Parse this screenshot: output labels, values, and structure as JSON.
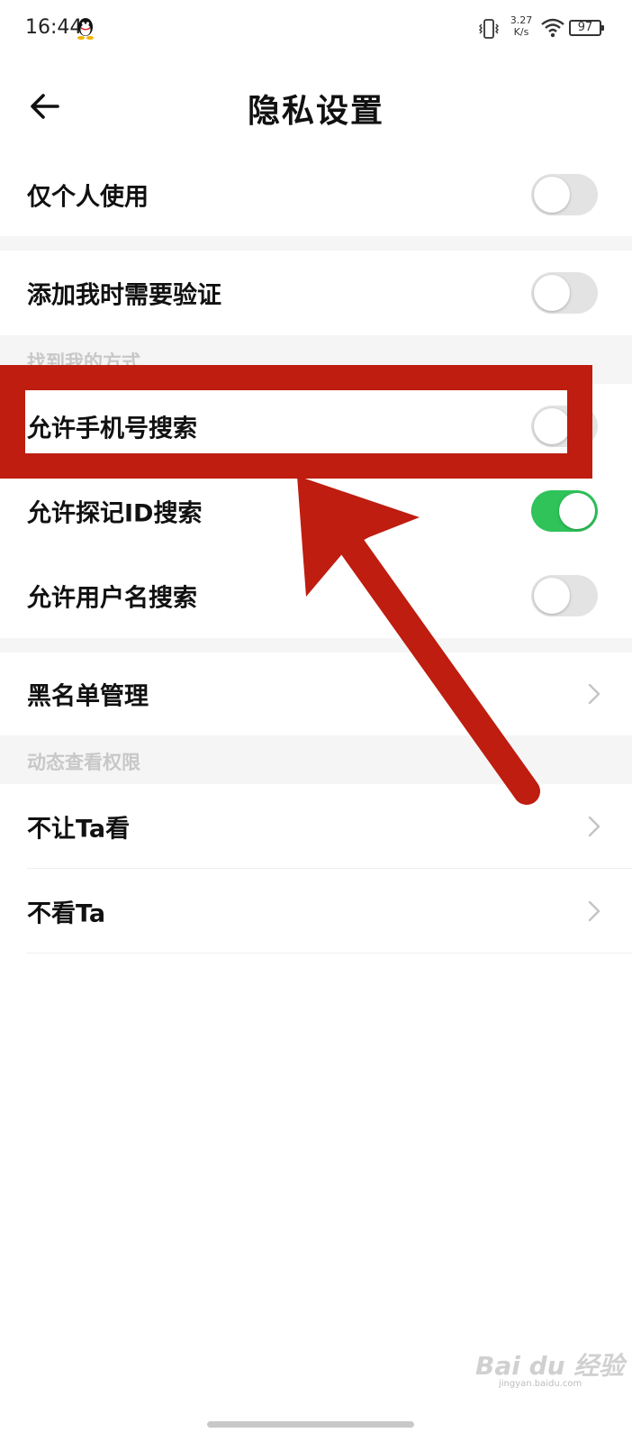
{
  "status_bar": {
    "time": "16:44",
    "net_speed_value": "3.27",
    "net_speed_unit": "K/s",
    "battery": "97"
  },
  "header": {
    "title": "隐私设置"
  },
  "rows": {
    "personal_only": {
      "label": "仅个人使用",
      "enabled": false
    },
    "verify_add": {
      "label": "添加我时需要验证",
      "enabled": false
    },
    "phone_search": {
      "label": "允许手机号搜索",
      "enabled": false
    },
    "id_search": {
      "label": "允许探记ID搜索",
      "enabled": true
    },
    "username_search": {
      "label": "允许用户名搜索",
      "enabled": false
    },
    "blacklist": {
      "label": "黑名单管理"
    },
    "hide_from": {
      "label": "不让Ta看"
    },
    "dont_see": {
      "label": "不看Ta"
    }
  },
  "sections": {
    "find_me": "找到我的方式",
    "moments_permission": "动态查看权限"
  },
  "colors": {
    "toggle_on": "#2fc35a",
    "toggle_off": "#e3e3e3",
    "annotation_red": "#be1d10",
    "section_gap": "#f5f5f5"
  },
  "watermark": {
    "text": "Bai du 经验",
    "url": "jingyan.baidu.com"
  }
}
